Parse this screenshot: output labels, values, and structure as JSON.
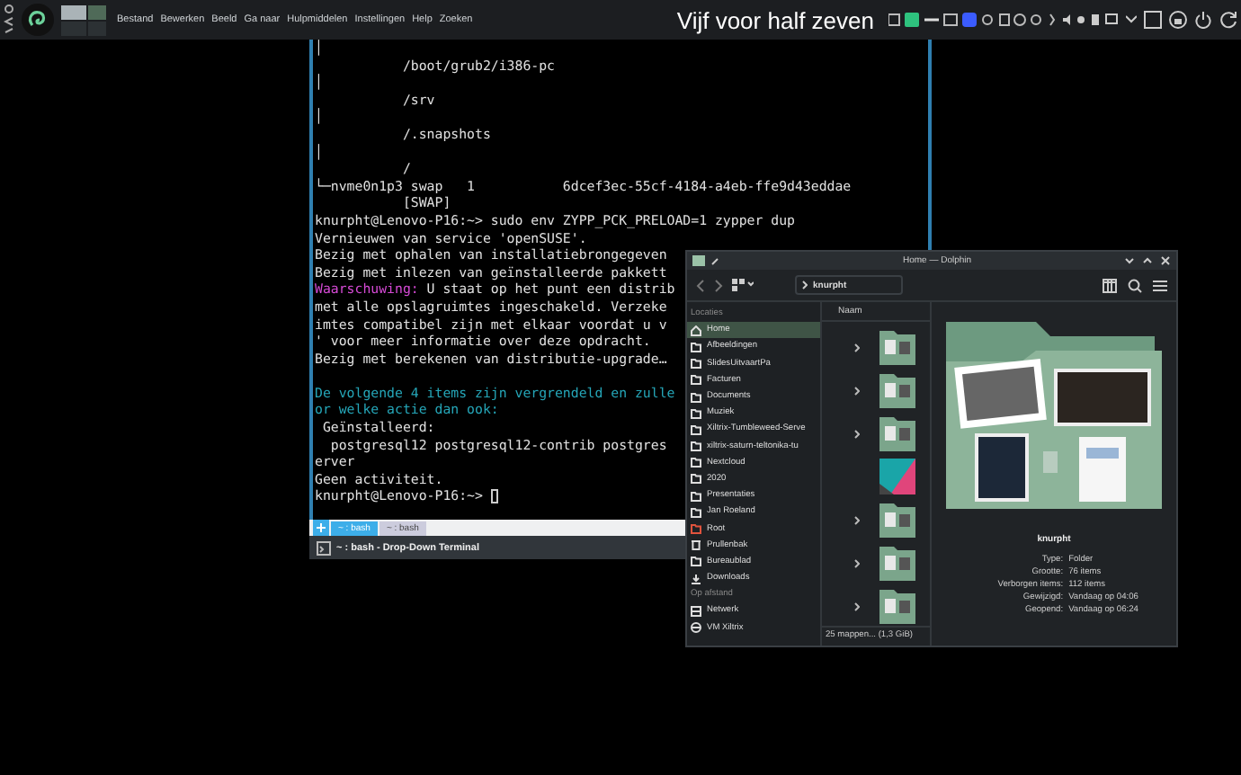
{
  "panel": {
    "menu": [
      "Bestand",
      "Bewerken",
      "Beeld",
      "Ga naar",
      "Hulpmiddelen",
      "Instellingen",
      "Help",
      "Zoeken"
    ],
    "clock": "Vijf voor half zeven"
  },
  "terminal": {
    "lines": [
      {
        "kind": "text",
        "segments": [
          {
            "text": "│",
            "kind": "plain"
          }
        ]
      },
      {
        "kind": "text",
        "segments": [
          {
            "text": "           /boot/grub2/i386-pc",
            "kind": "plain"
          }
        ]
      },
      {
        "kind": "text",
        "segments": [
          {
            "text": "│",
            "kind": "plain"
          }
        ]
      },
      {
        "kind": "text",
        "segments": [
          {
            "text": "           /srv",
            "kind": "plain"
          }
        ]
      },
      {
        "kind": "text",
        "segments": [
          {
            "text": "│",
            "kind": "plain"
          }
        ]
      },
      {
        "kind": "text",
        "segments": [
          {
            "text": "           /.snapshots",
            "kind": "plain"
          }
        ]
      },
      {
        "kind": "text",
        "segments": [
          {
            "text": "│",
            "kind": "plain"
          }
        ]
      },
      {
        "kind": "text",
        "segments": [
          {
            "text": "           /",
            "kind": "plain"
          }
        ]
      },
      {
        "kind": "text",
        "segments": [
          {
            "text": "└─nvme0n1p3 swap   1           6dcef3ec-55cf-4184-a4eb-ffe9d43eddae",
            "kind": "plain"
          }
        ]
      },
      {
        "kind": "text",
        "segments": [
          {
            "text": "           [SWAP]",
            "kind": "plain"
          }
        ]
      },
      {
        "kind": "text",
        "segments": [
          {
            "text": "knurpht@Lenovo-P16:~> sudo env ZYPP_PCK_PRELOAD=1 zypper dup",
            "kind": "plain"
          }
        ]
      },
      {
        "kind": "text",
        "segments": [
          {
            "text": "Vernieuwen van service 'openSUSE'.",
            "kind": "plain"
          }
        ]
      },
      {
        "kind": "text",
        "segments": [
          {
            "text": "Bezig met ophalen van installatiebrongegeven",
            "kind": "plain"
          }
        ]
      },
      {
        "kind": "text",
        "segments": [
          {
            "text": "Bezig met inlezen van geïnstalleerde pakkett",
            "kind": "plain"
          }
        ]
      },
      {
        "kind": "text",
        "segments": [
          {
            "text": "Waarschuwing:",
            "kind": "warning"
          },
          {
            "text": " U staat op het punt een distrib",
            "kind": "plain"
          }
        ]
      },
      {
        "kind": "text",
        "segments": [
          {
            "text": "met alle opslagruimtes ingeschakeld. Verzeke",
            "kind": "plain"
          }
        ]
      },
      {
        "kind": "text",
        "segments": [
          {
            "text": "imtes compatibel zijn met elkaar voordat u v",
            "kind": "plain"
          }
        ]
      },
      {
        "kind": "text",
        "segments": [
          {
            "text": "' voor meer informatie over deze opdracht.",
            "kind": "plain"
          }
        ]
      },
      {
        "kind": "text",
        "segments": [
          {
            "text": "Bezig met berekenen van distributie-upgrade…",
            "kind": "plain"
          }
        ]
      },
      {
        "kind": "blank"
      },
      {
        "kind": "text",
        "segments": [
          {
            "text": "De volgende 4 items zijn vergrendeld en zulle",
            "kind": "info"
          }
        ]
      },
      {
        "kind": "text",
        "segments": [
          {
            "text": "or welke actie dan ook:",
            "kind": "info"
          }
        ]
      },
      {
        "kind": "text",
        "segments": [
          {
            "text": " Geïnstalleerd:",
            "kind": "plain"
          }
        ]
      },
      {
        "kind": "text",
        "segments": [
          {
            "text": "  postgresql12 postgresql12-contrib postgres",
            "kind": "plain"
          }
        ]
      },
      {
        "kind": "text",
        "segments": [
          {
            "text": "erver",
            "kind": "plain"
          }
        ]
      },
      {
        "kind": "text",
        "segments": [
          {
            "text": "Geen activiteit.",
            "kind": "plain"
          }
        ]
      },
      {
        "kind": "text",
        "segments": [
          {
            "text": "knurpht@Lenovo-P16:~> ",
            "kind": "plain"
          }
        ]
      }
    ],
    "cursor": true,
    "tabs": [
      {
        "label": "~ : bash",
        "selected": true
      },
      {
        "label": "~ : bash",
        "selected": false
      }
    ],
    "title": "~ : bash - Drop-Down Terminal"
  },
  "dolphin": {
    "title": "Home — Dolphin",
    "breadcrumb": "knurpht",
    "places": [
      {
        "kind": "header",
        "label": "Locaties"
      },
      {
        "kind": "home",
        "label": "Home",
        "selected": true
      },
      {
        "kind": "folder",
        "label": "Afbeeldingen",
        "selected": false
      },
      {
        "kind": "folder",
        "label": "SlidesUitvaartPa",
        "selected": false
      },
      {
        "kind": "folder",
        "label": "Facturen",
        "selected": false
      },
      {
        "kind": "folder",
        "label": "Documents",
        "selected": false
      },
      {
        "kind": "folder",
        "label": "Muziek",
        "selected": false
      },
      {
        "kind": "folder",
        "label": "Xiltrix-Tumbleweed-Serve",
        "selected": false
      },
      {
        "kind": "folder",
        "label": "xiltrix-saturn-teltonika-tu",
        "selected": false
      },
      {
        "kind": "folder",
        "label": "Nextcloud",
        "selected": false
      },
      {
        "kind": "folder",
        "label": "2020",
        "selected": false
      },
      {
        "kind": "folder",
        "label": "Presentaties",
        "selected": false
      },
      {
        "kind": "folder",
        "label": "Jan Roeland",
        "selected": false
      },
      {
        "kind": "root",
        "label": "Root",
        "selected": false
      },
      {
        "kind": "trash",
        "label": "Prullenbak",
        "selected": false
      },
      {
        "kind": "folder",
        "label": "Bureaublad",
        "selected": false
      },
      {
        "kind": "download",
        "label": "Downloads",
        "selected": false
      },
      {
        "kind": "header",
        "label": "Op afstand"
      },
      {
        "kind": "network",
        "label": "Netwerk",
        "selected": false
      },
      {
        "kind": "globe",
        "label": "VM Xiltrix",
        "selected": false
      }
    ],
    "column": "Naam",
    "items": [
      {
        "kind": "folder"
      },
      {
        "kind": "folder"
      },
      {
        "kind": "folder"
      },
      {
        "kind": "image"
      },
      {
        "kind": "folder"
      },
      {
        "kind": "folder"
      },
      {
        "kind": "folder"
      }
    ],
    "status": "25 mappen... (1,3 GiB)",
    "info": {
      "name": "knurpht",
      "rows": [
        {
          "label": "Type:",
          "value": "Folder"
        },
        {
          "label": "Grootte:",
          "value": "76 items"
        },
        {
          "label": "Verborgen items:",
          "value": "112 items"
        },
        {
          "label": "Gewijzigd:",
          "value": "Vandaag op 04:06"
        },
        {
          "label": "Geopend:",
          "value": "Vandaag op 06:24"
        }
      ]
    }
  }
}
